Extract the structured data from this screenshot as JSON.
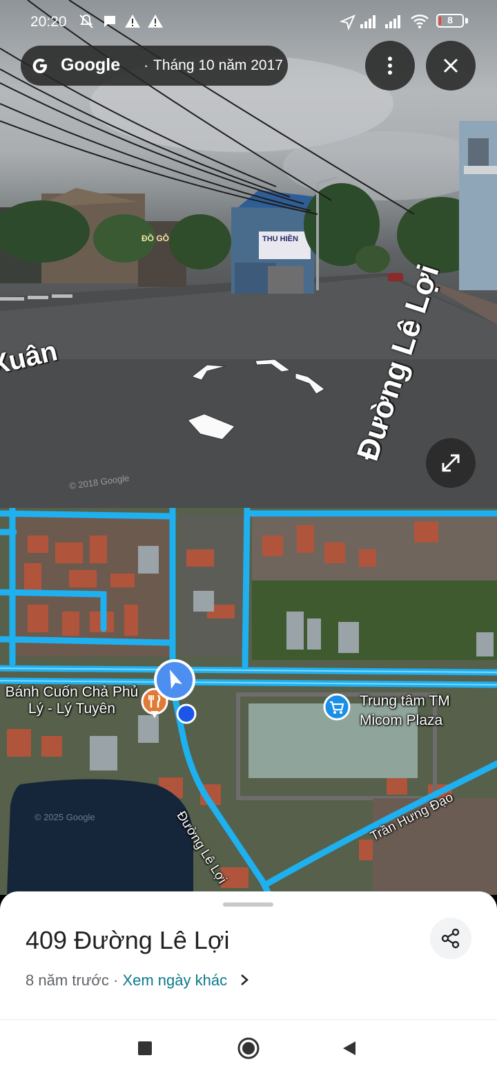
{
  "status_bar": {
    "time": "20:20",
    "battery": "8",
    "icons": [
      "mute-icon",
      "chat-icon",
      "warning-icon",
      "warning-icon",
      "location-arrow-icon",
      "signal-icon",
      "signal-icon",
      "wifi-icon",
      "battery-icon"
    ]
  },
  "street_view": {
    "brand": "Google",
    "date": "Tháng 10 năm 2017",
    "street_label_left": "Xuân",
    "street_label_right": "Đường Lê Lợi",
    "sign_text": "ĐỒ GỖ",
    "shop_sign": "THU HIỀN",
    "watermark": "© 2018 Google",
    "icons": {
      "google_logo": "google-g-icon",
      "menu": "more-vert-icon",
      "close": "close-icon",
      "expand": "expand-icon"
    }
  },
  "map": {
    "poi_restaurant": "Bánh Cuốn Chả Phủ Lý - Lý Tuyên",
    "poi_mall_line1": "Trung tâm TM",
    "poi_mall_line2": "Micom Plaza",
    "road_le_loi": "Đường Lê Lợi",
    "road_tran_hung_dao": "Trần Hưng Đạo",
    "watermark": "© 2025 Google"
  },
  "sheet": {
    "title": "409 Đường Lê Lợi",
    "age": "8 năm trước",
    "separator": "·",
    "link": "Xem ngày khác"
  },
  "colors": {
    "road_highlight": "#1fb0f0",
    "link": "#0b7a8a",
    "marker": "#1a73e8"
  }
}
